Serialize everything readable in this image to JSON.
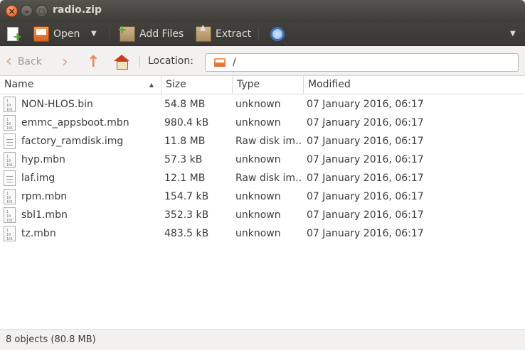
{
  "window": {
    "title": "radio.zip"
  },
  "toolbar": {
    "open_label": "Open",
    "add_files_label": "Add Files",
    "extract_label": "Extract"
  },
  "nav": {
    "back_label": "Back",
    "location_label": "Location:",
    "location_value": "/"
  },
  "columns": {
    "name": "Name",
    "size": "Size",
    "type": "Type",
    "modified": "Modified"
  },
  "files": [
    {
      "name": "NON-HLOS.bin",
      "size": "54.8 MB",
      "type": "unknown",
      "modified": "07 January 2016, 06:17",
      "icon": "binary"
    },
    {
      "name": "emmc_appsboot.mbn",
      "size": "980.4 kB",
      "type": "unknown",
      "modified": "07 January 2016, 06:17",
      "icon": "binary"
    },
    {
      "name": "factory_ramdisk.img",
      "size": "11.8 MB",
      "type": "Raw disk im…",
      "modified": "07 January 2016, 06:17",
      "icon": "text"
    },
    {
      "name": "hyp.mbn",
      "size": "57.3 kB",
      "type": "unknown",
      "modified": "07 January 2016, 06:17",
      "icon": "binary"
    },
    {
      "name": "laf.img",
      "size": "12.1 MB",
      "type": "Raw disk im…",
      "modified": "07 January 2016, 06:17",
      "icon": "text"
    },
    {
      "name": "rpm.mbn",
      "size": "154.7 kB",
      "type": "unknown",
      "modified": "07 January 2016, 06:17",
      "icon": "binary"
    },
    {
      "name": "sbl1.mbn",
      "size": "352.3 kB",
      "type": "unknown",
      "modified": "07 January 2016, 06:17",
      "icon": "binary"
    },
    {
      "name": "tz.mbn",
      "size": "483.5 kB",
      "type": "unknown",
      "modified": "07 January 2016, 06:17",
      "icon": "binary"
    }
  ],
  "status": {
    "text": "8 objects (80.8 MB)"
  }
}
